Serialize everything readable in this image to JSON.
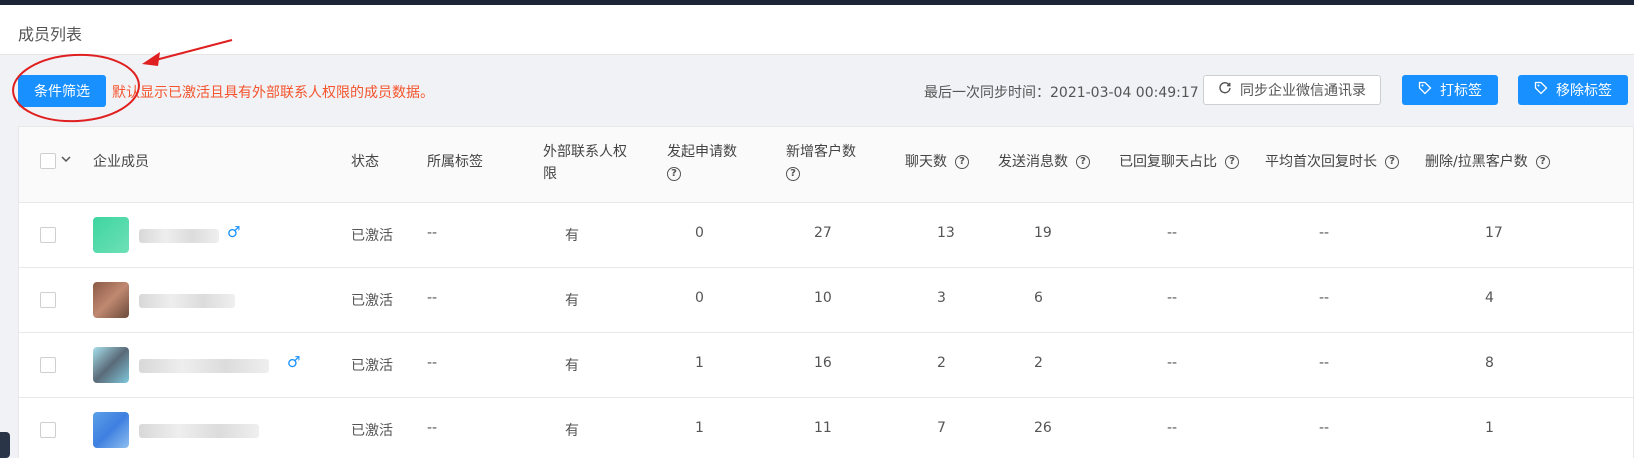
{
  "page": {
    "title": "成员列表"
  },
  "toolbar": {
    "filter_label": "条件筛选",
    "hint": "默认显示已激活且具有外部联系人权限的成员数据。",
    "sync_time": "最后一次同步时间：2021-03-04 00:49:17",
    "sync_label": "同步企业微信通讯录",
    "tag_label": "打标签",
    "untag_label": "移除标签"
  },
  "table": {
    "headers": {
      "member": "企业成员",
      "status": "状态",
      "tags": "所属标签",
      "external": "外部联系人权限",
      "requests": "发起申请数",
      "new_customers": "新增客户数",
      "chats": "聊天数",
      "messages": "发送消息数",
      "reply_ratio": "已回复聊天占比",
      "avg_first_reply": "平均首次回复时长",
      "deleted": "删除/拉黑客户数"
    },
    "rows": [
      {
        "status": "已激活",
        "tags": "--",
        "external": "有",
        "requests": "0",
        "new_customers": "27",
        "chats": "13",
        "messages": "19",
        "reply_ratio": "--",
        "avg_first_reply": "--",
        "deleted": "17",
        "gender": "♂"
      },
      {
        "status": "已激活",
        "tags": "--",
        "external": "有",
        "requests": "0",
        "new_customers": "10",
        "chats": "3",
        "messages": "6",
        "reply_ratio": "--",
        "avg_first_reply": "--",
        "deleted": "4",
        "gender": ""
      },
      {
        "status": "已激活",
        "tags": "--",
        "external": "有",
        "requests": "1",
        "new_customers": "16",
        "chats": "2",
        "messages": "2",
        "reply_ratio": "--",
        "avg_first_reply": "--",
        "deleted": "8",
        "gender": "♂"
      },
      {
        "status": "已激活",
        "tags": "--",
        "external": "有",
        "requests": "1",
        "new_customers": "11",
        "chats": "7",
        "messages": "26",
        "reply_ratio": "--",
        "avg_first_reply": "--",
        "deleted": "1",
        "gender": ""
      }
    ]
  },
  "colors": {
    "primary": "#1890ff",
    "hint": "#f5542d",
    "annotation": "#e02020"
  }
}
